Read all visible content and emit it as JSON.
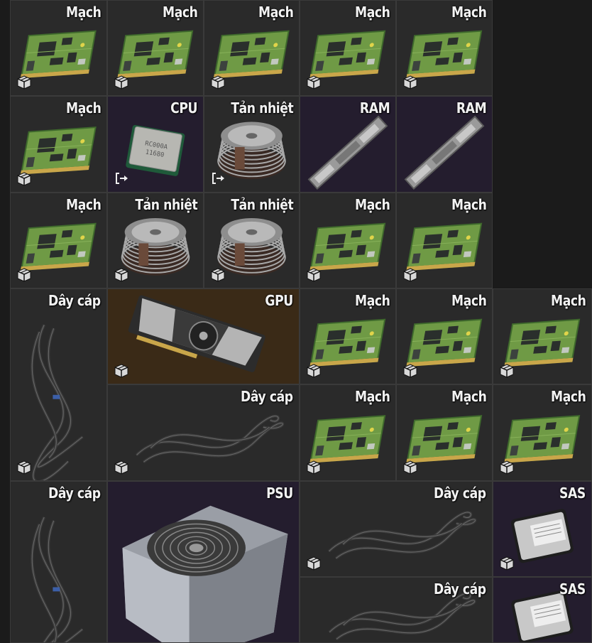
{
  "inventory": {
    "items": [
      {
        "id": "r1c1",
        "label": "Mạch",
        "type": "board",
        "badge": "box"
      },
      {
        "id": "r1c2",
        "label": "Mạch",
        "type": "board",
        "badge": "box"
      },
      {
        "id": "r1c3",
        "label": "Mạch",
        "type": "board",
        "badge": "box"
      },
      {
        "id": "r1c4",
        "label": "Mạch",
        "type": "board",
        "badge": "box"
      },
      {
        "id": "r1c5",
        "label": "Mạch",
        "type": "board",
        "badge": "box"
      },
      {
        "id": "r2c1",
        "label": "Mạch",
        "type": "board",
        "badge": "box"
      },
      {
        "id": "r2c2",
        "label": "CPU",
        "type": "cpu",
        "badge": "arrow",
        "bg": "purple"
      },
      {
        "id": "r2c3",
        "label": "Tản nhiệt",
        "type": "cooler",
        "badge": "arrow"
      },
      {
        "id": "r2c4",
        "label": "RAM",
        "type": "ram",
        "bg": "purple"
      },
      {
        "id": "r2c5",
        "label": "RAM",
        "type": "ram",
        "bg": "purple"
      },
      {
        "id": "r3c1",
        "label": "Mạch",
        "type": "board",
        "badge": "box"
      },
      {
        "id": "r3c2",
        "label": "Tản nhiệt",
        "type": "cooler",
        "badge": "box"
      },
      {
        "id": "r3c3",
        "label": "Tản nhiệt",
        "type": "cooler",
        "badge": "box"
      },
      {
        "id": "r3c4",
        "label": "Mạch",
        "type": "board",
        "badge": "box"
      },
      {
        "id": "r3c5",
        "label": "Mạch",
        "type": "board",
        "badge": "box"
      },
      {
        "id": "cable-a",
        "label": "Dây cáp",
        "type": "cable-v",
        "badge": "box"
      },
      {
        "id": "gpu",
        "label": "GPU",
        "type": "gpu",
        "badge": "box",
        "bg": "gold"
      },
      {
        "id": "r4c4",
        "label": "Mạch",
        "type": "board",
        "badge": "box"
      },
      {
        "id": "r4c5",
        "label": "Mạch",
        "type": "board",
        "badge": "box"
      },
      {
        "id": "r4c6",
        "label": "Mạch",
        "type": "board",
        "badge": "box"
      },
      {
        "id": "cable-b",
        "label": "Dây cáp",
        "type": "cable-h",
        "badge": "box"
      },
      {
        "id": "r5c4",
        "label": "Mạch",
        "type": "board",
        "badge": "box"
      },
      {
        "id": "r5c5",
        "label": "Mạch",
        "type": "board",
        "badge": "box"
      },
      {
        "id": "r5c6",
        "label": "Mạch",
        "type": "board",
        "badge": "box"
      },
      {
        "id": "cable-c",
        "label": "Dây cáp",
        "type": "cable-v"
      },
      {
        "id": "psu",
        "label": "PSU",
        "type": "psu",
        "bg": "purple"
      },
      {
        "id": "cable-d",
        "label": "Dây cáp",
        "type": "cable-h",
        "badge": "box"
      },
      {
        "id": "sas-1",
        "label": "SAS",
        "type": "hdd",
        "badge": "box",
        "bg": "purple"
      },
      {
        "id": "cable-e",
        "label": "Dây cáp",
        "type": "cable-h"
      },
      {
        "id": "sas-2",
        "label": "SAS",
        "type": "hdd",
        "bg": "purple"
      }
    ]
  }
}
